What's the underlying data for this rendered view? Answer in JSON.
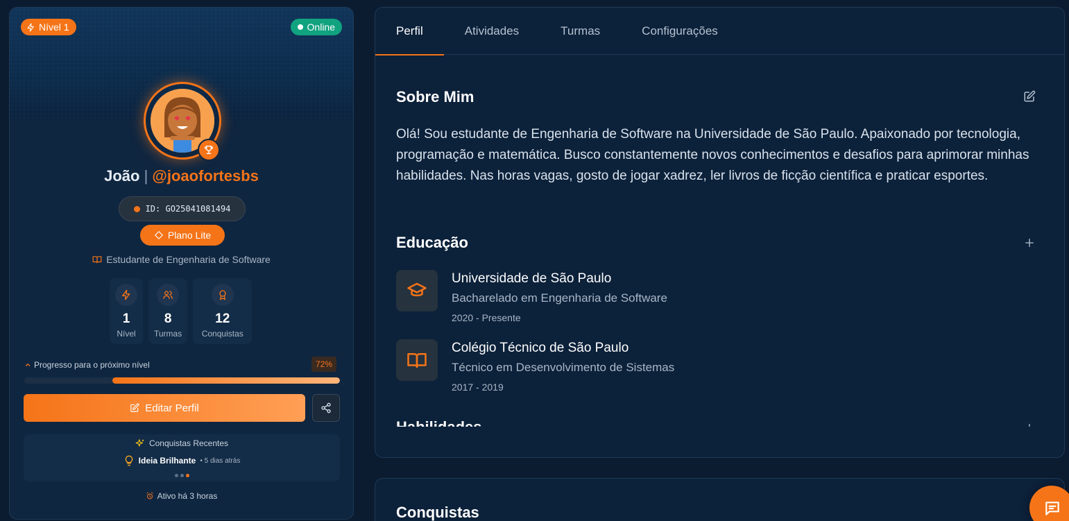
{
  "profile": {
    "level_badge": "Nível 1",
    "status": "Online",
    "name": "João",
    "name_separator": "|",
    "handle": "@joaofortesbs",
    "id_text": "ID: GO25041081494",
    "plan": "Plano Lite",
    "occupation": "Estudante de Engenharia de Software",
    "stats": [
      {
        "icon": "lightning-icon",
        "value": "1",
        "label": "Nível"
      },
      {
        "icon": "users-icon",
        "value": "8",
        "label": "Turmas"
      },
      {
        "icon": "award-icon",
        "value": "12",
        "label": "Conquistas"
      }
    ],
    "progress": {
      "label": "Progresso para o próximo nível",
      "percent_text": "72%",
      "value": 0.72
    },
    "edit_button": "Editar Perfil",
    "recent_achievements": {
      "title": "Conquistas Recentes",
      "item_name": "Ideia Brilhante",
      "item_time": "• 5 dias atrás"
    },
    "active_text": "Ativo há 3 horas"
  },
  "tabs": [
    "Perfil",
    "Atividades",
    "Turmas",
    "Configurações"
  ],
  "about": {
    "title": "Sobre Mim",
    "text": "Olá! Sou estudante de Engenharia de Software na Universidade de São Paulo. Apaixonado por tecnologia, programação e matemática. Busco constantemente novos conhecimentos e desafios para aprimorar minhas habilidades. Nas horas vagas, gosto de jogar xadrez, ler livros de ficção científica e praticar esportes."
  },
  "education": {
    "title": "Educação",
    "items": [
      {
        "icon": "graduation-cap-icon",
        "institution": "Universidade de São Paulo",
        "degree": "Bacharelado em Engenharia de Software",
        "dates": "2020 - Presente"
      },
      {
        "icon": "book-icon",
        "institution": "Colégio Técnico de São Paulo",
        "degree": "Técnico em Desenvolvimento de Sistemas",
        "dates": "2017 - 2019"
      }
    ]
  },
  "skills": {
    "title": "Habilidades"
  },
  "achievements": {
    "title": "Conquistas"
  },
  "colors": {
    "accent": "#f57418",
    "online": "#11a27f",
    "background": "#0b1c30",
    "card": "#0f2640"
  }
}
